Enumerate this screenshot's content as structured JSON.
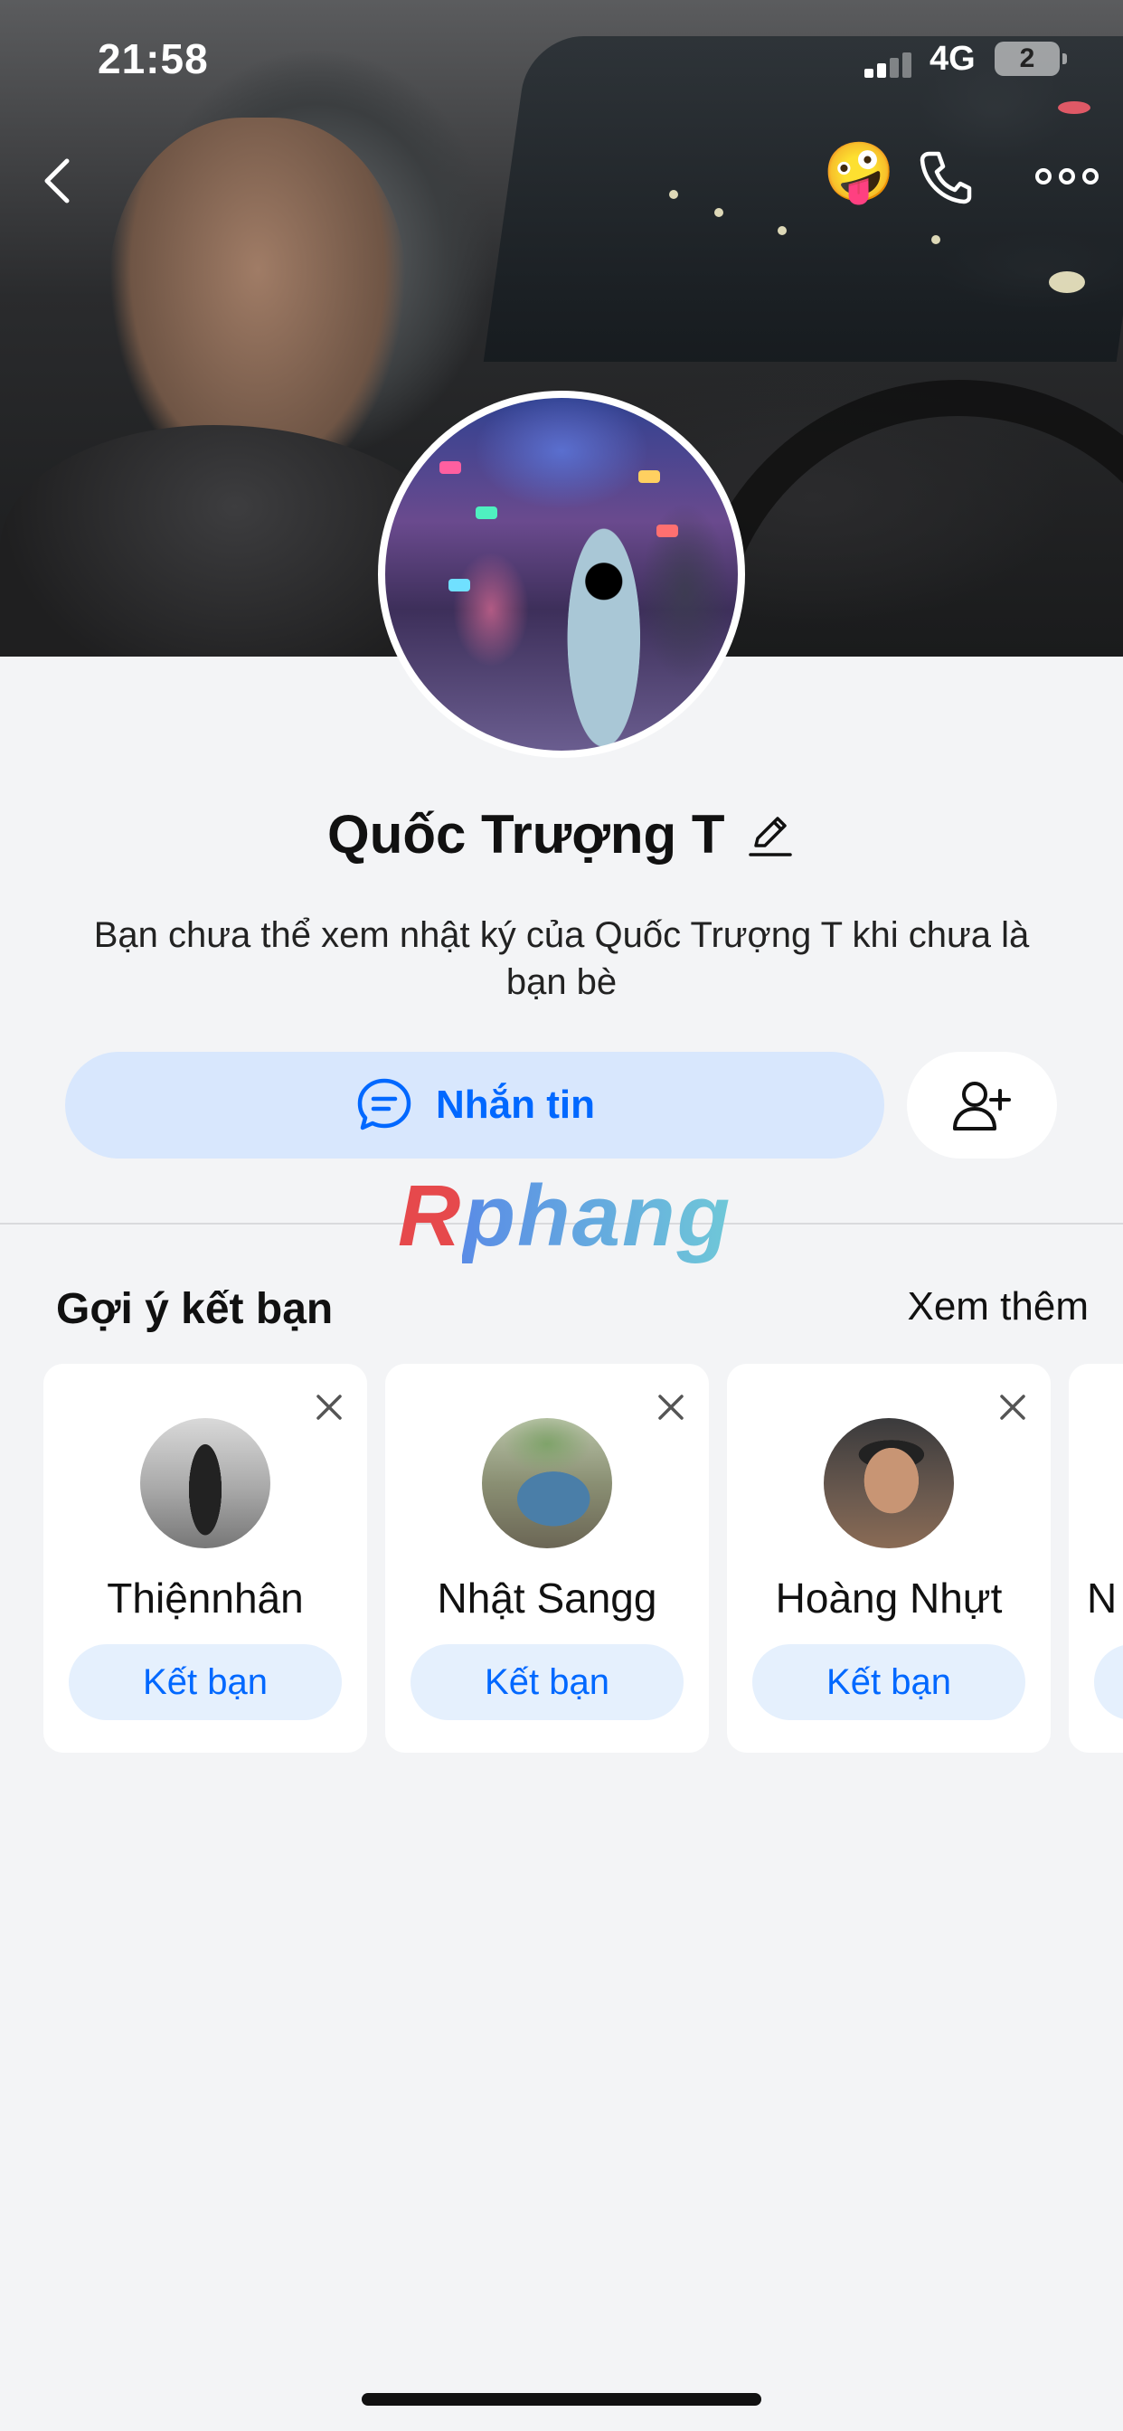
{
  "status_bar": {
    "time": "21:58",
    "network": "4G",
    "battery": "2"
  },
  "header": {
    "back_icon": "chevron-left-icon",
    "emoji_icon": "zany-face-emoji",
    "emoji": "🤪",
    "call_icon": "phone-icon",
    "more_icon": "more-horizontal-icon"
  },
  "profile": {
    "name": "Quốc Trượng T",
    "edit_icon": "pencil-icon",
    "notice": "Bạn chưa thể xem nhật ký của Quốc Trượng T khi chưa là bạn bè"
  },
  "actions": {
    "message_label": "Nhắn tin",
    "message_icon": "chat-bubble-icon",
    "add_friend_icon": "add-user-icon"
  },
  "watermark": {
    "part1": "R",
    "part2": "phang"
  },
  "suggestions": {
    "title": "Gợi ý kết bạn",
    "see_more": "Xem thêm",
    "items": [
      {
        "name": "Thiệnnhân",
        "button": "Kết bạn"
      },
      {
        "name": "Nhật Sangg",
        "button": "Kết bạn"
      },
      {
        "name": "Hoàng Nhựt",
        "button": "Kết bạn"
      },
      {
        "name": "N",
        "button": ""
      }
    ]
  },
  "colors": {
    "accent": "#0068ff",
    "button_bg": "#d8e7fd",
    "page_bg": "#f3f4f6"
  }
}
